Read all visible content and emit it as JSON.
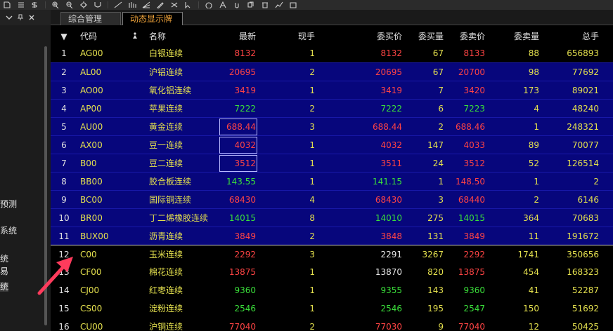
{
  "toolbar": {
    "icons": [
      "page-icon",
      "list-icon",
      "dollar-icon",
      "zoom-in-icon",
      "zoom-out-icon",
      "gear-icon",
      "magnet-icon",
      "line-icon",
      "bar-icon",
      "fan-icon",
      "pencil-icon",
      "scissors-icon",
      "cursor-icon",
      "circle-icon",
      "text-icon",
      "paperclip-icon",
      "copy-icon",
      "trash-icon",
      "chart-icon",
      "square-icon"
    ]
  },
  "left": {
    "items": [
      {
        "label": "预测",
        "y": 0
      },
      {
        "label": "系统",
        "y": 0
      },
      {
        "label": "统",
        "y": 0
      },
      {
        "label": "易",
        "y": 0
      },
      {
        "label": "统",
        "y": 0
      }
    ]
  },
  "tabs": [
    "综合管理",
    "动态显示牌"
  ],
  "headers": {
    "sort": "▼",
    "code": "代码",
    "name": "名称",
    "last": "最新",
    "hand": "现手",
    "bid": "委买价",
    "bidv": "委买量",
    "ask": "委卖价",
    "askv": "委卖量",
    "total": "总手"
  },
  "rows": [
    {
      "n": "1",
      "code": "AG00",
      "name": "白银连续",
      "last": "8132",
      "lastc": "red",
      "hand": "1",
      "bid": "8132",
      "bidc": "red",
      "bidv": "67",
      "ask": "8133",
      "askc": "red",
      "askv": "88",
      "total": "656893",
      "sel": false
    },
    {
      "n": "2",
      "code": "AL00",
      "name": "沪铝连续",
      "last": "20695",
      "lastc": "red",
      "hand": "2",
      "bid": "20695",
      "bidc": "red",
      "bidv": "67",
      "ask": "20700",
      "askc": "red",
      "askv": "98",
      "total": "77692",
      "sel": true
    },
    {
      "n": "3",
      "code": "AO00",
      "name": "氧化铝连续",
      "last": "3419",
      "lastc": "red",
      "hand": "1",
      "bid": "3419",
      "bidc": "red",
      "bidv": "7",
      "ask": "3420",
      "askc": "red",
      "askv": "173",
      "total": "89021",
      "sel": true
    },
    {
      "n": "4",
      "code": "AP00",
      "name": "苹果连续",
      "last": "7222",
      "lastc": "green",
      "hand": "2",
      "bid": "7222",
      "bidc": "green",
      "bidv": "6",
      "ask": "7223",
      "askc": "green",
      "askv": "4",
      "total": "48240",
      "sel": true
    },
    {
      "n": "5",
      "code": "AU00",
      "name": "黄金连续",
      "last": "688.44",
      "lastc": "red",
      "hand": "3",
      "bid": "688.44",
      "bidc": "red",
      "bidv": "2",
      "ask": "688.46",
      "askc": "red",
      "askv": "1",
      "total": "248321",
      "sel": true,
      "box": true
    },
    {
      "n": "6",
      "code": "AX00",
      "name": "豆一连续",
      "last": "4032",
      "lastc": "red",
      "hand": "1",
      "bid": "4032",
      "bidc": "red",
      "bidv": "147",
      "ask": "4033",
      "askc": "red",
      "askv": "89",
      "total": "70077",
      "sel": true,
      "box": true
    },
    {
      "n": "7",
      "code": "B00",
      "name": "豆二连续",
      "last": "3512",
      "lastc": "red",
      "hand": "1",
      "bid": "3511",
      "bidc": "red",
      "bidv": "24",
      "ask": "3512",
      "askc": "red",
      "askv": "52",
      "total": "126514",
      "sel": true,
      "box": true
    },
    {
      "n": "8",
      "code": "BB00",
      "name": "胶合板连续",
      "last": "143.55",
      "lastc": "green",
      "hand": "1",
      "bid": "141.15",
      "bidc": "green",
      "bidv": "1",
      "ask": "148.50",
      "askc": "red",
      "askv": "1",
      "total": "2",
      "sel": true
    },
    {
      "n": "9",
      "code": "BC00",
      "name": "国际铜连续",
      "last": "68430",
      "lastc": "red",
      "hand": "4",
      "bid": "68430",
      "bidc": "red",
      "bidv": "3",
      "ask": "68440",
      "askc": "red",
      "askv": "2",
      "total": "6146",
      "sel": true
    },
    {
      "n": "10",
      "code": "BR00",
      "name": "丁二烯橡胶连续",
      "last": "14015",
      "lastc": "green",
      "hand": "8",
      "bid": "14010",
      "bidc": "green",
      "bidv": "275",
      "ask": "14015",
      "askc": "green",
      "askv": "364",
      "total": "70683",
      "sel": true
    },
    {
      "n": "11",
      "code": "BUX00",
      "name": "沥青连续",
      "last": "3849",
      "lastc": "red",
      "hand": "2",
      "bid": "3848",
      "bidc": "red",
      "bidv": "131",
      "ask": "3849",
      "askc": "red",
      "askv": "11",
      "total": "191672",
      "sel": true
    },
    {
      "n": "12",
      "code": "C00",
      "name": "玉米连续",
      "last": "2292",
      "lastc": "red",
      "hand": "3",
      "bid": "2291",
      "bidc": "white",
      "bidv": "3267",
      "ask": "2292",
      "askc": "red",
      "askv": "1741",
      "total": "350656",
      "sel": false,
      "first": true
    },
    {
      "n": "13",
      "code": "CF00",
      "name": "棉花连续",
      "last": "13875",
      "lastc": "red",
      "hand": "1",
      "bid": "13870",
      "bidc": "white",
      "bidv": "820",
      "ask": "13875",
      "askc": "red",
      "askv": "454",
      "total": "168323",
      "sel": false
    },
    {
      "n": "14",
      "code": "CJ00",
      "name": "红枣连续",
      "last": "9360",
      "lastc": "green",
      "hand": "1",
      "bid": "9355",
      "bidc": "green",
      "bidv": "143",
      "ask": "9360",
      "askc": "green",
      "askv": "41",
      "total": "52287",
      "sel": false
    },
    {
      "n": "15",
      "code": "CS00",
      "name": "淀粉连续",
      "last": "2546",
      "lastc": "green",
      "hand": "1",
      "bid": "2546",
      "bidc": "green",
      "bidv": "195",
      "ask": "2547",
      "askc": "green",
      "askv": "150",
      "total": "51692",
      "sel": false
    },
    {
      "n": "16",
      "code": "CU00",
      "name": "沪铜连续",
      "last": "77040",
      "lastc": "red",
      "hand": "2",
      "bid": "77030",
      "bidc": "red",
      "bidv": "9",
      "ask": "77040",
      "askc": "red",
      "askv": "12",
      "total": "50425",
      "sel": false
    }
  ]
}
